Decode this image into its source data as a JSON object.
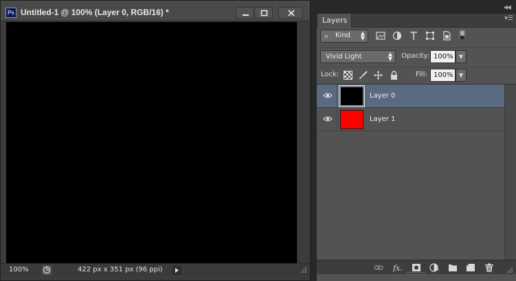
{
  "document": {
    "logo": "Ps",
    "title": "Untitled-1 @ 100% (Layer 0, RGB/16) *",
    "controls": [
      "minimize-icon",
      "maximize-icon",
      "close-icon"
    ],
    "status": {
      "zoom": "100%",
      "info": "422 px x 351 px (96 ppi)"
    },
    "canvas_color": "#000000"
  },
  "layers_panel": {
    "tab_label": "Layers",
    "filter": {
      "kind_label": "Kind",
      "icons": [
        "pixel-layer-filter-icon",
        "adjustment-layer-filter-icon",
        "type-layer-filter-icon",
        "shape-layer-filter-icon",
        "smart-object-filter-icon",
        "filter-toggle-icon"
      ]
    },
    "blend_mode": "Vivid Light",
    "opacity_label": "Opacity:",
    "opacity_value": "100%",
    "lock_label": "Lock:",
    "lock_icons": [
      "lock-transparent-pixels-icon",
      "lock-image-pixels-icon",
      "lock-position-icon",
      "lock-all-icon"
    ],
    "fill_label": "Fill:",
    "fill_value": "100%",
    "layers": [
      {
        "name": "Layer 0",
        "visible": true,
        "selected": true,
        "thumb_color": "#000000"
      },
      {
        "name": "Layer 1",
        "visible": true,
        "selected": false,
        "thumb_color": "#ff0000"
      }
    ],
    "bottom_icons": [
      "link-layers-icon",
      "fx-icon",
      "add-mask-icon",
      "new-adjustment-layer-icon",
      "new-group-icon",
      "new-layer-icon",
      "delete-layer-icon"
    ],
    "selection_color": "#5a6a80"
  }
}
